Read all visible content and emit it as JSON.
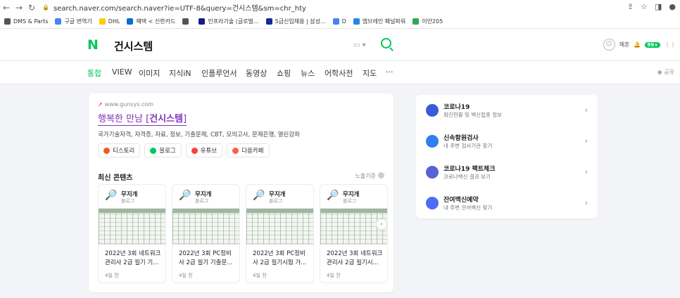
{
  "browser": {
    "url": "search.naver.com/search.naver?ie=UTF-8&query=건시스템&sm=chr_hty",
    "bookmarks": [
      {
        "label": "DMS & Parts",
        "color": "#555555"
      },
      {
        "label": "구글 번역기",
        "color": "#4285f4"
      },
      {
        "label": "DHL",
        "color": "#ffcc00"
      },
      {
        "label": "혜택 < 신한카드",
        "color": "#0a6ed1"
      },
      {
        "label": "",
        "color": "#555555"
      },
      {
        "label": "인프라기술 (글로벌...",
        "color": "#1a1a8c"
      },
      {
        "label": "5급신입채용 | 삼성...",
        "color": "#1428a0"
      },
      {
        "label": "D",
        "color": "#4285f4"
      },
      {
        "label": "엠브레인 패널파워",
        "color": "#1e88e5"
      },
      {
        "label": "이안205",
        "color": "#34a853"
      }
    ]
  },
  "header": {
    "logo": "N",
    "query": "건시스템",
    "user": "혜혼",
    "notif_count": "99+"
  },
  "tabs": [
    "통합",
    "VIEW",
    "이미지",
    "지식iN",
    "인플루언서",
    "동영상",
    "쇼핑",
    "뉴스",
    "어학사전",
    "지도",
    "···"
  ],
  "share_label": "공유",
  "site": {
    "url": "www.gunsys.com",
    "title_prefix": "행복한 만남 [",
    "title_bold": "건시스템",
    "title_suffix": "]",
    "desc": "국가기술자격, 자격증, 자료, 정보, 기출문제, CBT, 모의고사, 문제은행, 열린강좌",
    "chips": [
      {
        "label": "티스토리",
        "color": "#f05b22"
      },
      {
        "label": "블로그",
        "color": "#03c75a"
      },
      {
        "label": "유튜브",
        "color": "#ff3d3d"
      },
      {
        "label": "다음카페",
        "color": "#ff5a4d"
      }
    ]
  },
  "latest": {
    "title": "최신 콘텐츠",
    "criteria": "노출기준",
    "items": [
      {
        "name": "무지개",
        "source": "블로그",
        "title": "2022년 3회 네트워크관리사 2급 필기 기...",
        "ago": "4일 전"
      },
      {
        "name": "무지개",
        "source": "블로그",
        "title": "2022년 3회 PC정비사 2급 필기 기출문...",
        "ago": "4일 전"
      },
      {
        "name": "무지개",
        "source": "블로그",
        "title": "2022년 3회 PC정비사 2급 필기시험 가...",
        "ago": "4일 전"
      },
      {
        "name": "무지개",
        "source": "블로그",
        "title": "2022년 3회 네트워크관리사 2급 필기시...",
        "ago": "4일 전"
      }
    ]
  },
  "right_links": [
    {
      "title": "코로나19",
      "sub": "확진현황 및 백신접종 정보",
      "color": "#3b5bdb"
    },
    {
      "title": "신속항원검사",
      "sub": "내 주변 검사기관 찾기",
      "color": "#2f80ed"
    },
    {
      "title": "코로나19 팩트체크",
      "sub": "코로나백신 결과 보기",
      "color": "#5563d6"
    },
    {
      "title": "잔여백신예약",
      "sub": "내 주변 잔여백신 찾기",
      "color": "#4a6cf7"
    }
  ]
}
